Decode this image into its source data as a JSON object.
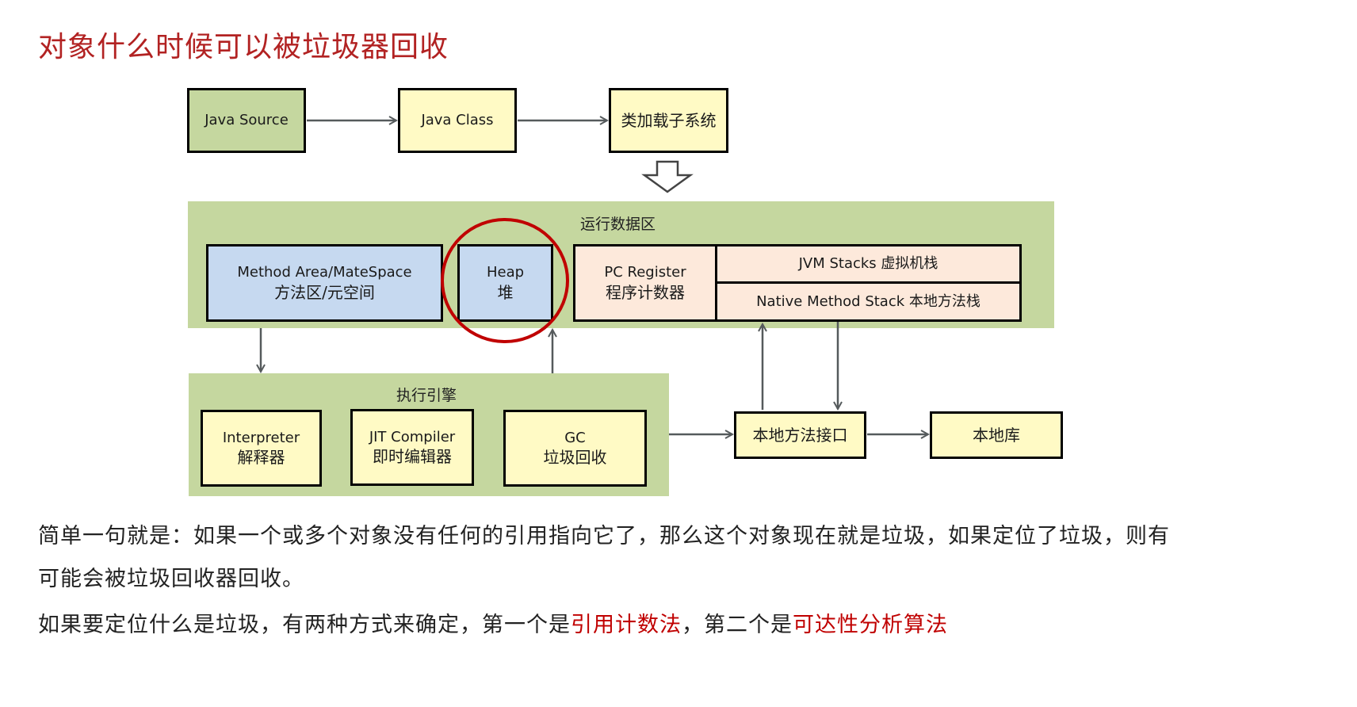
{
  "title": "对象什么时候可以被垃圾器回收",
  "diagram": {
    "top_row": {
      "java_source": "Java Source",
      "java_class": "Java Class",
      "class_loader": "类加载子系统"
    },
    "runtime_data_area": {
      "label": "运行数据区",
      "method_area_en": "Method Area/MateSpace",
      "method_area_zh": "方法区/元空间",
      "heap_en": "Heap",
      "heap_zh": "堆",
      "pc_register_en": "PC Register",
      "pc_register_zh": "程序计数器",
      "jvm_stacks": "JVM Stacks 虚拟机栈",
      "native_method_stack": "Native Method Stack 本地方法栈"
    },
    "execution_engine": {
      "label": "执行引擎",
      "interpreter_en": "Interpreter",
      "interpreter_zh": "解释器",
      "jit_en": "JIT Compiler",
      "jit_zh": "即时编辑器",
      "gc_en": "GC",
      "gc_zh": "垃圾回收"
    },
    "native_interface": "本地方法接口",
    "native_library": "本地库",
    "highlight_color": "#c00000"
  },
  "paragraphs": {
    "p1_line1": "简单一句就是：如果一个或多个对象没有任何的引用指向它了，那么这个对象现在就是垃圾，如果定位了垃圾，则有",
    "p1_line2": "可能会被垃圾回收器回收。",
    "p2_prefix": "如果要定位什么是垃圾，有两种方式来确定，第一个是",
    "p2_method1": "引用计数法",
    "p2_middle": "，第二个是",
    "p2_method2": "可达性分析算法"
  }
}
